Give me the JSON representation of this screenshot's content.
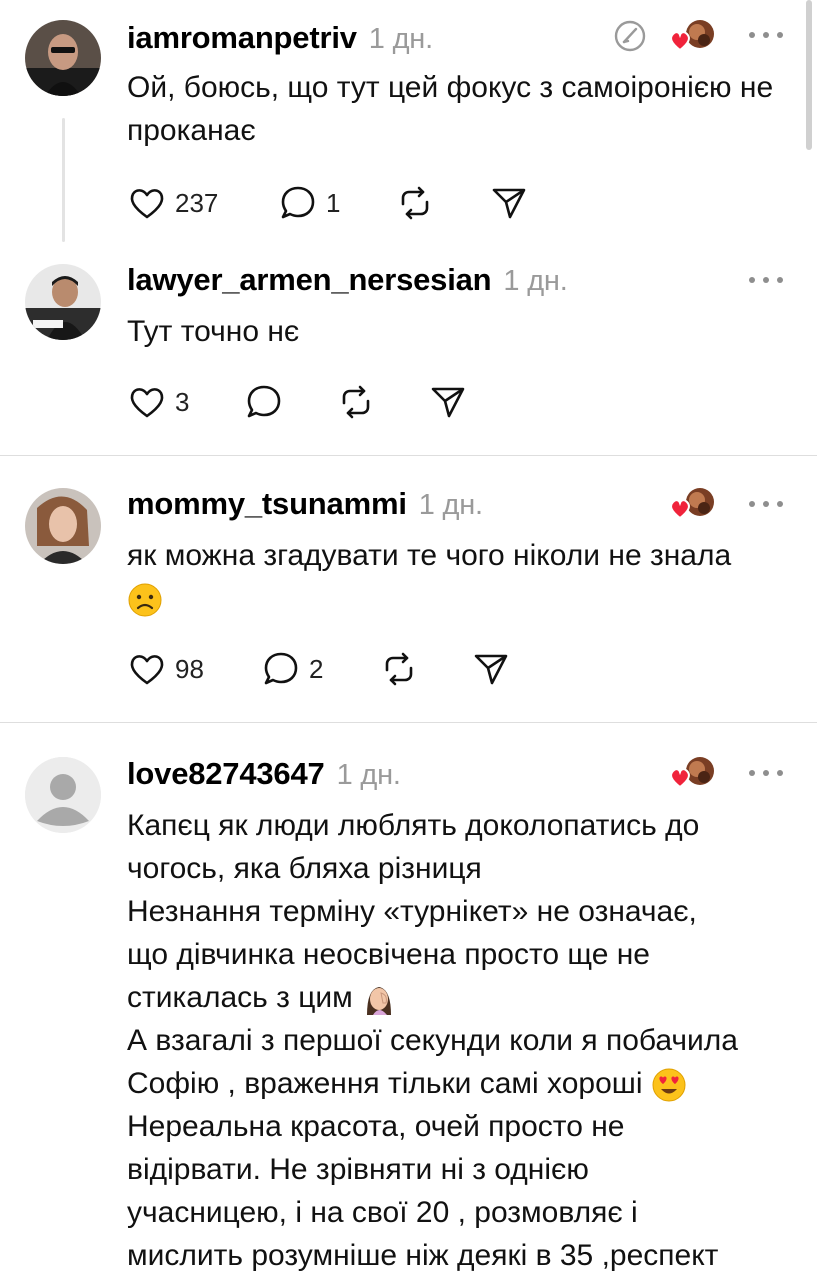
{
  "posts": [
    {
      "username": "iamromanpetriv",
      "time": "1 дн.",
      "text": "Ой, боюсь, що тут цей фокус з самоіронією не проканає",
      "likes": "237",
      "replies": "1"
    },
    {
      "username": "lawyer_armen_nersesian",
      "time": "1 дн.",
      "text": "Тут точно нє",
      "likes": "3",
      "replies": ""
    },
    {
      "username": "mommy_tsunammi",
      "time": "1 дн.",
      "text": "як можна згадувати те чого ніколи не знала",
      "likes": "98",
      "replies": "2"
    },
    {
      "username": "love82743647",
      "time": "1 дн.",
      "lines": [
        "Капєц як люди люблять доколопатись до",
        "чогось, яка бляха різниця",
        "Незнання терміну «турнікет» не означає,",
        "що дівчинка неосвічена просто ще не",
        "стикалась з цим",
        "А взагалі з першої секунди коли я побачила",
        "Софію , враження тільки самі хороші",
        "Нереальна красота, очей просто не",
        "відірвати. Не зрівняти ні з однією",
        "учасницею, і на свої 20 , розмовляє і",
        "мислить розумніше ніж деякі в 35 ,респект"
      ]
    }
  ],
  "colors": {
    "heart": "#f0233b",
    "muted": "#9a9a9a",
    "divider": "#dedede"
  },
  "icons": [
    "heart-icon",
    "comment-icon",
    "repost-icon",
    "share-icon",
    "more-icon",
    "edit-icon",
    "liked-by-creator-icon",
    "frowning-face-emoji",
    "facepalm-emoji",
    "heart-eyes-emoji"
  ]
}
